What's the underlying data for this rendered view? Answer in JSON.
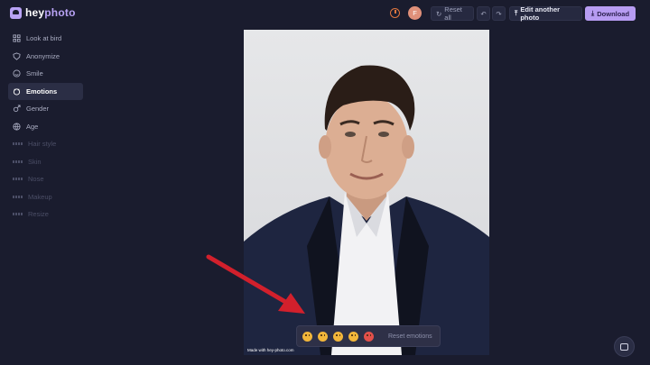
{
  "app": {
    "logo_prefix": "hey",
    "logo_suffix": "photo"
  },
  "topbar": {
    "avatar_initial": "F",
    "reset_all": "Reset all",
    "edit_another": "Edit another photo",
    "download": "Download"
  },
  "sidebar": {
    "items": [
      {
        "label": "Look at bird",
        "icon": "bird-icon",
        "state": "normal"
      },
      {
        "label": "Anonymize",
        "icon": "shield-icon",
        "state": "normal"
      },
      {
        "label": "Smile",
        "icon": "smile-icon",
        "state": "normal"
      },
      {
        "label": "Emotions",
        "icon": "emotions-icon",
        "state": "active"
      },
      {
        "label": "Gender",
        "icon": "gender-icon",
        "state": "normal"
      },
      {
        "label": "Age",
        "icon": "age-icon",
        "state": "normal"
      },
      {
        "label": "Hair style",
        "icon": "locked-icon",
        "state": "disabled"
      },
      {
        "label": "Skin",
        "icon": "locked-icon",
        "state": "disabled"
      },
      {
        "label": "Nose",
        "icon": "locked-icon",
        "state": "disabled"
      },
      {
        "label": "Makeup",
        "icon": "locked-icon",
        "state": "disabled"
      },
      {
        "label": "Resize",
        "icon": "locked-icon",
        "state": "disabled"
      }
    ]
  },
  "photo": {
    "watermark": "Made with hey-photo.com"
  },
  "emotions": {
    "options": [
      "surprised",
      "sad",
      "neutral",
      "happy",
      "angry"
    ],
    "reset_label": "Reset emotions"
  },
  "colors": {
    "accent": "#b79cf2",
    "background": "#1a1c2e",
    "arrow": "#d2202c"
  }
}
